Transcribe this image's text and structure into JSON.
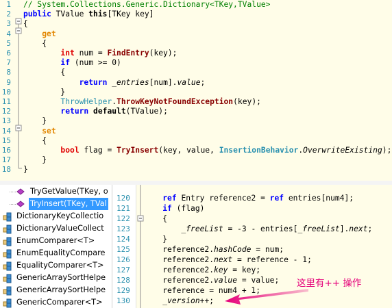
{
  "top_editor": {
    "lines": [
      {
        "n": "1",
        "html": "<span class=\"cm\">// System.Collections.Generic.Dictionary&lt;TKey,TValue&gt;</span>"
      },
      {
        "n": "2",
        "html": "<span class=\"kw\">public</span> <span class=\"tx\">TValue</span> <span class=\"kw\" style=\"color:#000\">this</span>[<span class=\"tx\">TKey</span> key]"
      },
      {
        "n": "3",
        "html": "{"
      },
      {
        "n": "4",
        "html": "    <span class=\"kw2\">get</span>"
      },
      {
        "n": "5",
        "html": "    {"
      },
      {
        "n": "6",
        "html": "        <span class=\"kw\" style=\"color:#e00000\">int</span> num = <span class=\"fn\">FindEntry</span>(key);"
      },
      {
        "n": "7",
        "html": "        <span class=\"kw\">if</span> (num &gt;= 0)"
      },
      {
        "n": "8",
        "html": "        {"
      },
      {
        "n": "9",
        "html": "            <span class=\"kw\">return</span> <span class=\"em\">_entries</span>[num].<span class=\"em\">value</span>;"
      },
      {
        "n": "10",
        "html": "        }"
      },
      {
        "n": "11",
        "html": "        <span class=\"ty\">ThrowHelper</span>.<span class=\"fn\">ThrowKeyNotFoundException</span>(key);"
      },
      {
        "n": "12",
        "html": "        <span class=\"kw\">return</span> <span class=\"kw\" style=\"color:#000\">default</span>(TValue);"
      },
      {
        "n": "13",
        "html": "    }"
      },
      {
        "n": "14",
        "html": "    <span class=\"kw2\">set</span>"
      },
      {
        "n": "15",
        "html": "    {"
      },
      {
        "n": "16",
        "html": "        <span class=\"kw\" style=\"color:#e00000\">bool</span> flag = <span class=\"fn\">TryInsert</span>(key, value, <span class=\"ty2\">InsertionBehavior</span>.<span class=\"em\">OverwriteExisting</span>);"
      },
      {
        "n": "17",
        "html": "    }"
      },
      {
        "n": "18",
        "html": "}"
      }
    ]
  },
  "tree": {
    "items": [
      {
        "label": "TryGetValue(TKey, o",
        "icon": "method-icon",
        "selected": false,
        "indent": true
      },
      {
        "label": "TryInsert(TKey, TVal",
        "icon": "method-icon",
        "selected": true,
        "indent": true
      },
      {
        "label": "DictionaryKeyCollectio",
        "icon": "class-icon",
        "selected": false,
        "indent": false
      },
      {
        "label": "DictionaryValueCollect",
        "icon": "class-icon",
        "selected": false,
        "indent": false
      },
      {
        "label": "EnumComparer<T>",
        "icon": "class-icon",
        "selected": false,
        "indent": false
      },
      {
        "label": "EnumEqualityCompare",
        "icon": "class-icon",
        "selected": false,
        "indent": false
      },
      {
        "label": "EqualityComparer<T>",
        "icon": "class-icon",
        "selected": false,
        "indent": false
      },
      {
        "label": "GenericArraySortHelpe",
        "icon": "class-icon",
        "selected": false,
        "indent": false
      },
      {
        "label": "GenericArraySortHelpe",
        "icon": "class-icon",
        "selected": false,
        "indent": false
      },
      {
        "label": "GenericComparer<T>",
        "icon": "class-icon",
        "selected": false,
        "indent": false
      }
    ]
  },
  "bottom_editor": {
    "lines": [
      {
        "n": "120",
        "html": "    <span class=\"kw\">ref</span> <span class=\"tx\">Entry</span> reference2 = <span class=\"kw\">ref</span> entries[num4];"
      },
      {
        "n": "121",
        "html": "    <span class=\"kw\">if</span> (flag)"
      },
      {
        "n": "122",
        "html": "    {"
      },
      {
        "n": "123",
        "html": "        <span class=\"em\">_freeList</span> = -3 - entries[<span class=\"em\">_freeList</span>].<span class=\"em\">next</span>;"
      },
      {
        "n": "124",
        "html": "    }"
      },
      {
        "n": "125",
        "html": "    reference2.<span class=\"em\">hashCode</span> = num;"
      },
      {
        "n": "126",
        "html": "    reference2.<span class=\"em\">next</span> = reference - 1;"
      },
      {
        "n": "127",
        "html": "    reference2.<span class=\"em\">key</span> = key;"
      },
      {
        "n": "128",
        "html": "    reference2.<span class=\"em\">value</span> = value;"
      },
      {
        "n": "129",
        "html": "    reference = num4 + 1;"
      },
      {
        "n": "130",
        "html": "    <span class=\"em\">_version</span>++;"
      }
    ]
  },
  "annotation": {
    "text": "这里有++ 操作",
    "color": "#e5007a"
  },
  "colors": {
    "editor_bg": "#fffde8",
    "line_number": "#2b91af",
    "selection": "#3399ff"
  }
}
